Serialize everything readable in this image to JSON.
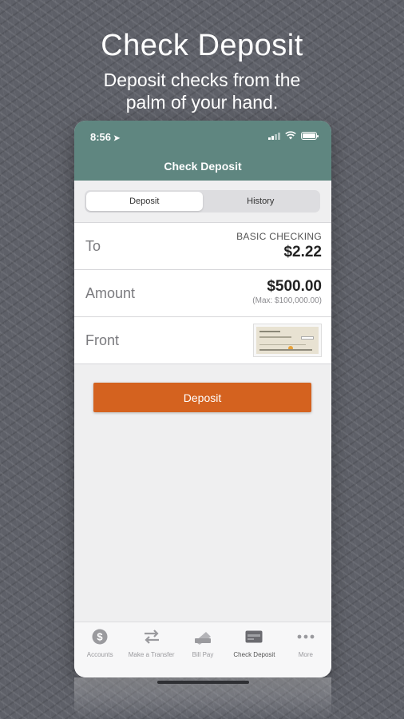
{
  "promo": {
    "headline": "Check Deposit",
    "subline_line1": "Deposit checks from the",
    "subline_line2": "palm of your hand."
  },
  "status_bar": {
    "time": "8:56",
    "location_icon": "location-arrow-icon"
  },
  "nav": {
    "title": "Check Deposit"
  },
  "segments": [
    {
      "label": "Deposit",
      "active": true
    },
    {
      "label": "History",
      "active": false
    }
  ],
  "form": {
    "to_label": "To",
    "account_name": "BASIC CHECKING",
    "account_balance": "$2.22",
    "amount_label": "Amount",
    "amount_value": "$500.00",
    "amount_max": "(Max: $100,000.00)",
    "front_label": "Front"
  },
  "deposit_button": "Deposit",
  "tabs": [
    {
      "label": "Accounts",
      "icon": "dollar-circle-icon"
    },
    {
      "label": "Make a Transfer",
      "icon": "transfer-arrows-icon"
    },
    {
      "label": "Bill Pay",
      "icon": "bill-pay-icon"
    },
    {
      "label": "Check Deposit",
      "icon": "check-card-icon",
      "active": true
    },
    {
      "label": "More",
      "icon": "more-dots-icon"
    }
  ],
  "colors": {
    "header": "#5f8680",
    "deposit_button": "#d4621f",
    "background": "#5e6068"
  }
}
